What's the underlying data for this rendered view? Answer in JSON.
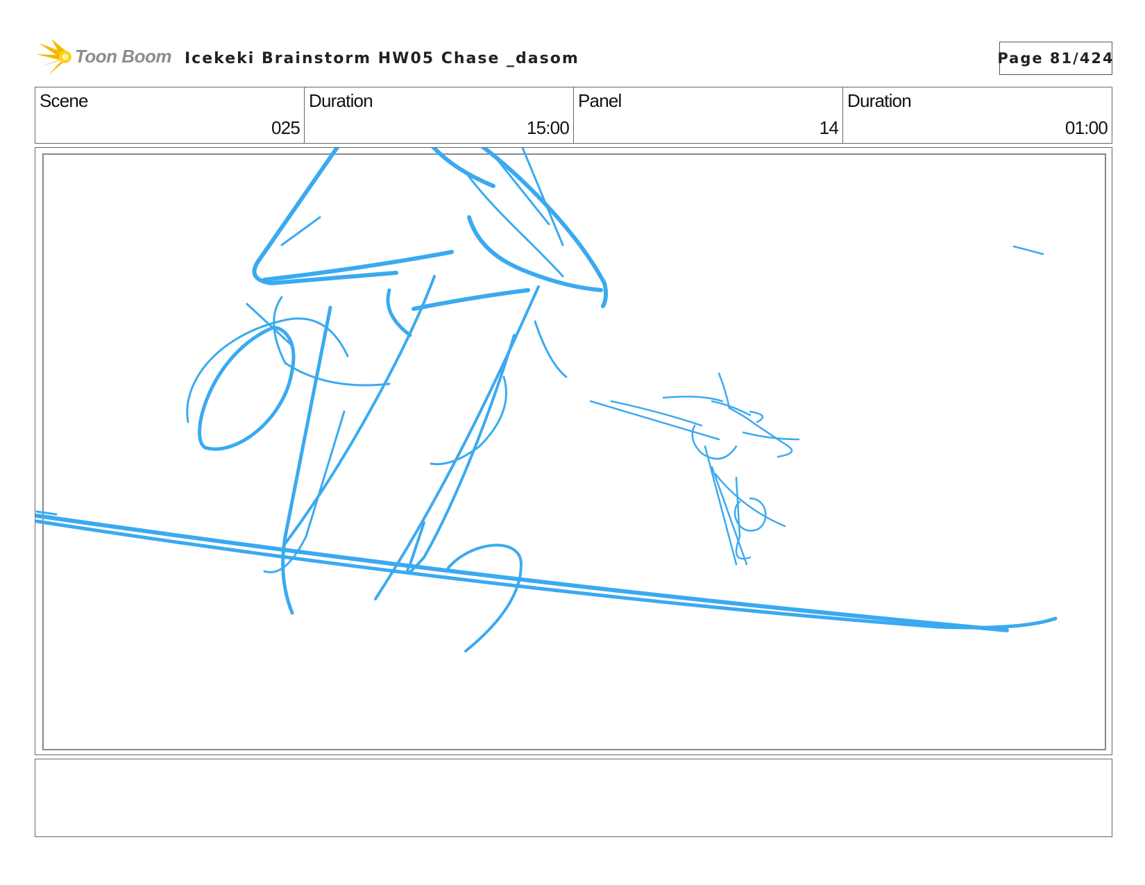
{
  "header": {
    "logo_text": "Toon Boom",
    "title": "Icekeki Brainstorm HW05 Chase _dasom",
    "page": "Page 81/424"
  },
  "info": {
    "scene_label": "Scene",
    "scene_value": "025",
    "scene_duration_label": "Duration",
    "scene_duration_value": "15:00",
    "panel_label": "Panel",
    "panel_value": "14",
    "panel_duration_label": "Duration",
    "panel_duration_value": "01:00"
  },
  "colors": {
    "sketch_stroke": "#3aaaf0",
    "logo_star": "#f5b800",
    "logo_text": "#8c8c8c",
    "border": "#666666"
  },
  "notes": {
    "text": ""
  }
}
